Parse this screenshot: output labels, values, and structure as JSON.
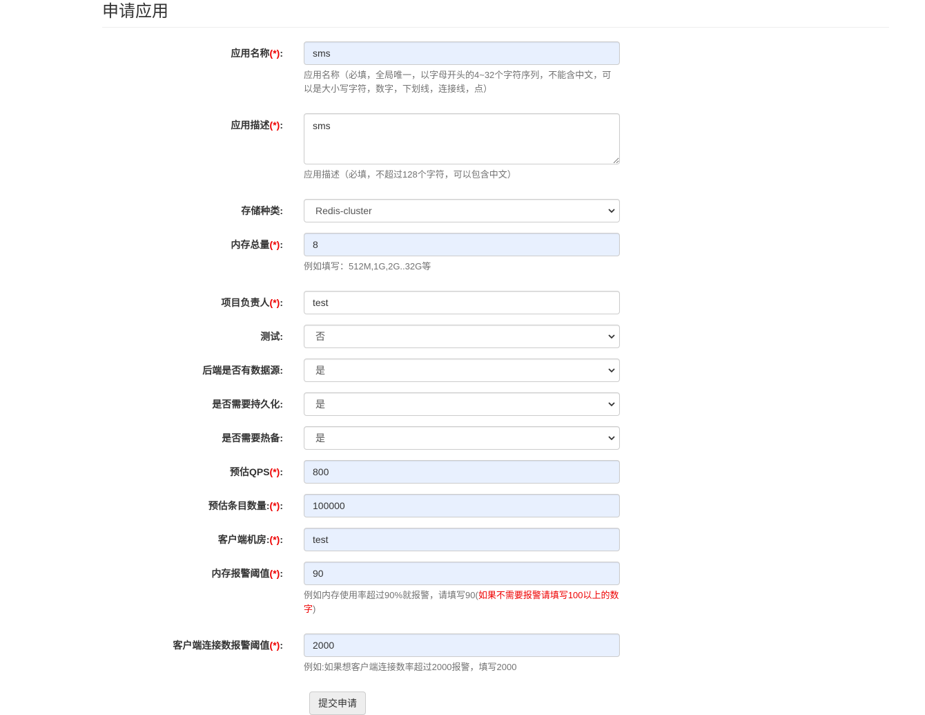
{
  "page": {
    "title": "申请应用"
  },
  "form": {
    "app_name": {
      "label": "应用名称",
      "required": "(*)",
      "colon": ":",
      "value": "sms",
      "help": "应用名称（必填，全局唯一，以字母开头的4~32个字符序列，不能含中文，可以是大小写字符，数字，下划线，连接线，点）"
    },
    "app_desc": {
      "label": "应用描述",
      "required": "(*)",
      "colon": ":",
      "value": "sms",
      "help": "应用描述（必填，不超过128个字符，可以包含中文）"
    },
    "storage_type": {
      "label": "存储种类",
      "colon": ":",
      "selected": "Redis-cluster"
    },
    "memory_total": {
      "label": "内存总量",
      "required": "(*)",
      "colon": ":",
      "value": "8",
      "help": "例如填写：512M,1G,2G..32G等"
    },
    "owner": {
      "label": "项目负责人",
      "required": "(*)",
      "colon": ":",
      "value": "test"
    },
    "is_test": {
      "label": "测试",
      "colon": ":",
      "selected": "否"
    },
    "has_backend_source": {
      "label": "后端是否有数据源",
      "colon": ":",
      "selected": "是"
    },
    "need_persistence": {
      "label": "是否需要持久化",
      "colon": ":",
      "selected": "是"
    },
    "need_hot_backup": {
      "label": "是否需要热备",
      "colon": ":",
      "selected": "是"
    },
    "est_qps": {
      "label": "预估QPS",
      "required": "(*)",
      "colon": ":",
      "value": "800"
    },
    "est_items": {
      "label": "预估条目数量:",
      "required": "(*)",
      "colon": ":",
      "value": "100000"
    },
    "client_idc": {
      "label": "客户端机房:",
      "required": "(*)",
      "colon": ":",
      "value": "test"
    },
    "mem_alert": {
      "label": "内存报警阈值",
      "required": "(*)",
      "colon": ":",
      "value": "90",
      "help_prefix": "例如内存使用率超过90%就报警，请填写90(",
      "help_warn": "如果不需要报警请填写100以上的数字",
      "help_suffix": ")"
    },
    "conn_alert": {
      "label": "客户端连接数报警阈值",
      "required": "(*)",
      "colon": ":",
      "value": "2000",
      "help": "例如:如果想客户端连接数率超过2000报警，填写2000"
    }
  },
  "actions": {
    "submit_label": "提交申请"
  }
}
